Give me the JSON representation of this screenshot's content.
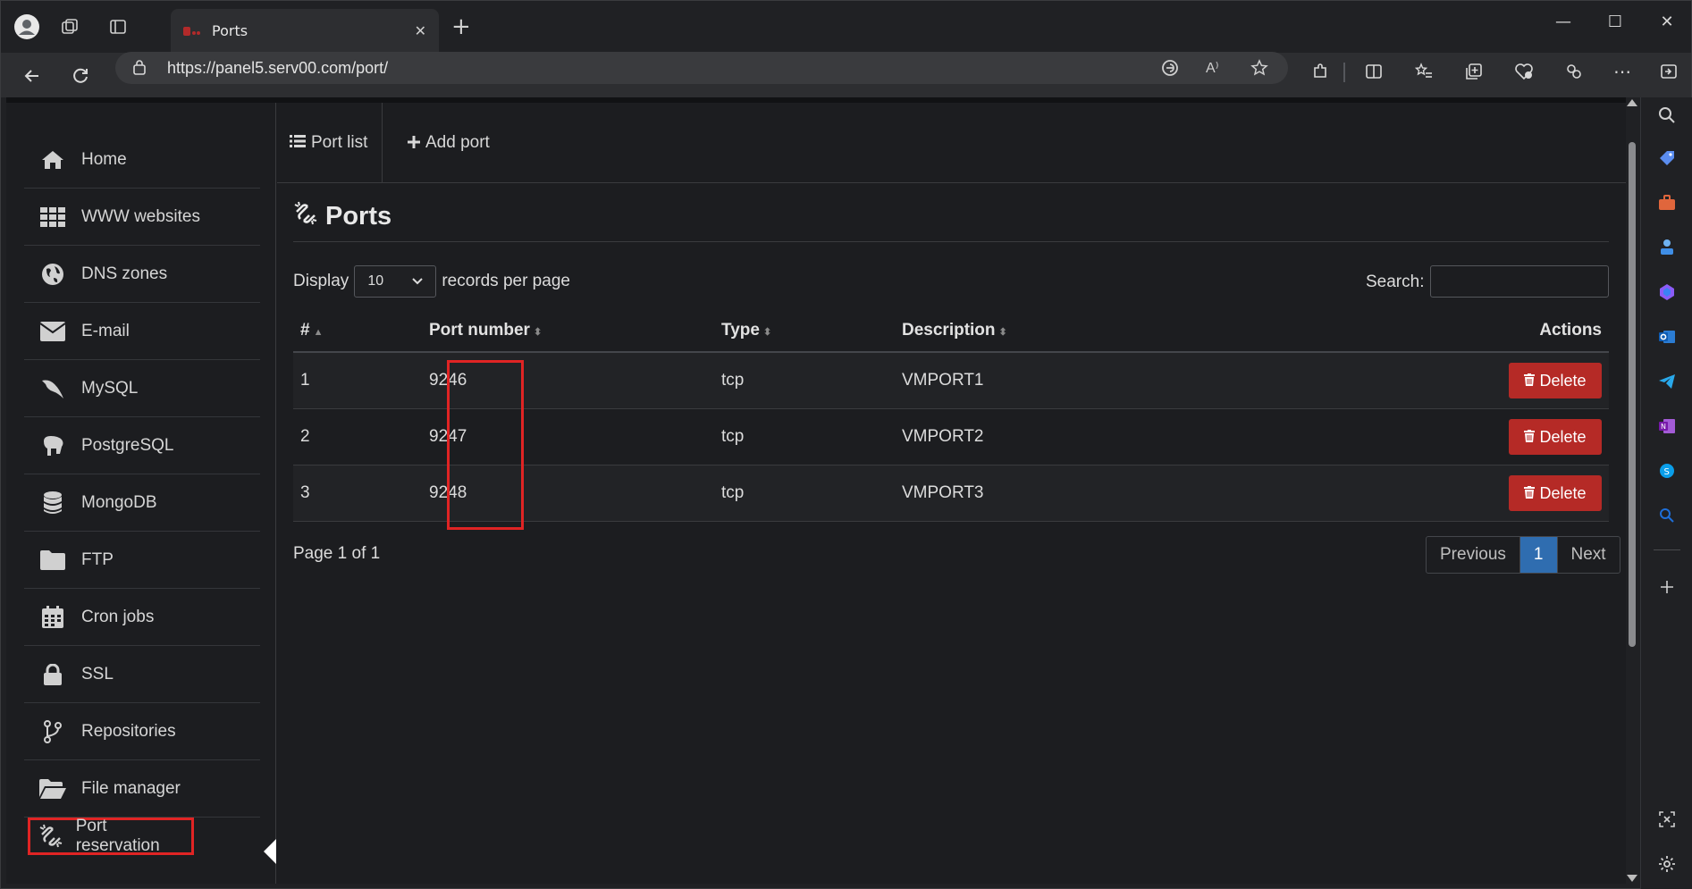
{
  "browser": {
    "tab_title": "Ports",
    "url": "https://panel5.serv00.com/port/",
    "tab_close": "✕",
    "new_tab": "+",
    "window_controls": [
      "—",
      "☐",
      "✕"
    ]
  },
  "sidebar": {
    "items": [
      {
        "label": "Home",
        "icon": "home-icon"
      },
      {
        "label": "WWW websites",
        "icon": "grid-icon"
      },
      {
        "label": "DNS zones",
        "icon": "globe-icon"
      },
      {
        "label": "E-mail",
        "icon": "envelope-icon"
      },
      {
        "label": "MySQL",
        "icon": "dolphin-icon"
      },
      {
        "label": "PostgreSQL",
        "icon": "elephant-icon"
      },
      {
        "label": "MongoDB",
        "icon": "database-icon"
      },
      {
        "label": "FTP",
        "icon": "folder-icon"
      },
      {
        "label": "Cron jobs",
        "icon": "calendar-icon"
      },
      {
        "label": "SSL",
        "icon": "lock-icon"
      },
      {
        "label": "Repositories",
        "icon": "branch-icon"
      },
      {
        "label": "File manager",
        "icon": "folder-open-icon"
      },
      {
        "label": "Port reservation",
        "icon": "unlink-icon"
      }
    ]
  },
  "main": {
    "tabs": [
      {
        "label": "Port list",
        "icon": "list-icon"
      },
      {
        "label": "Add port",
        "icon": "plus-icon"
      }
    ],
    "heading": "Ports",
    "display_label": "Display",
    "per_page_value": "10",
    "per_page_suffix": "records per page",
    "search_label": "Search:",
    "search_value": "",
    "table": {
      "columns": [
        "#",
        "Port number",
        "Type",
        "Description",
        "Actions"
      ],
      "rows": [
        {
          "num": "1",
          "port": "9246",
          "type": "tcp",
          "description": "VMPORT1",
          "action": "Delete"
        },
        {
          "num": "2",
          "port": "9247",
          "type": "tcp",
          "description": "VMPORT2",
          "action": "Delete"
        },
        {
          "num": "3",
          "port": "9248",
          "type": "tcp",
          "description": "VMPORT3",
          "action": "Delete"
        }
      ]
    },
    "page_info": "Page 1 of 1",
    "pagination": {
      "previous": "Previous",
      "current": "1",
      "next": "Next"
    }
  },
  "colors": {
    "accent": "#2f6db0",
    "danger": "#b52a26",
    "highlight": "#e02424"
  }
}
